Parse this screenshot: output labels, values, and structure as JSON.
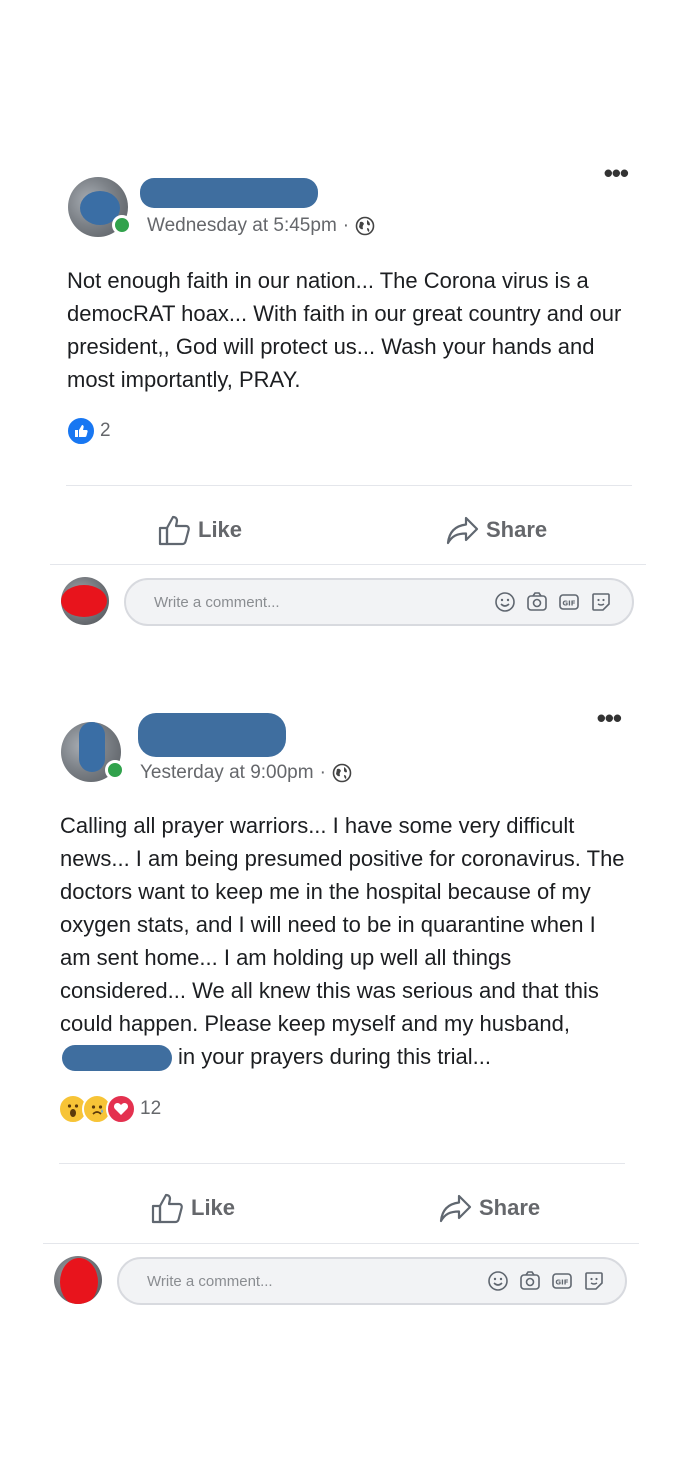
{
  "posts": [
    {
      "timestamp": "Wednesday at 5:45pm",
      "separator": "·",
      "audience_icon": "globe-icon",
      "text": "Not enough faith in our nation... The Corona virus is a democRAT hoax... With faith in our great country and our president,, God will protect us... Wash your hands and most importantly, PRAY.",
      "reactions": [
        "like"
      ],
      "reaction_count": "2",
      "like_label": "Like",
      "share_label": "Share",
      "comment_placeholder": "Write a comment..."
    },
    {
      "timestamp": "Yesterday at 9:00pm",
      "separator": "·",
      "audience_icon": "globe-icon",
      "text": "Calling all prayer warriors... I have some very difficult news... I am being presumed positive for coronavirus. The doctors want to keep me in the hospital because of my oxygen stats, and I will need to be in quarantine when I am sent home... I am holding up well all things considered... We all knew this was serious and that this could happen. Please keep myself and my",
      "text_before_redaction": "husband,",
      "text_after_redaction": "in your prayers during this trial...",
      "reactions": [
        "wow",
        "sad",
        "love"
      ],
      "reaction_count": "12",
      "like_label": "Like",
      "share_label": "Share",
      "comment_placeholder": "Write a comment..."
    }
  ],
  "colors": {
    "redaction_blue": "#3f6e9f",
    "redaction_red": "#e8141c",
    "online_green": "#31a24c",
    "like_blue": "#1877f2",
    "love_red": "#e4314f",
    "meta_gray": "#65676b"
  }
}
